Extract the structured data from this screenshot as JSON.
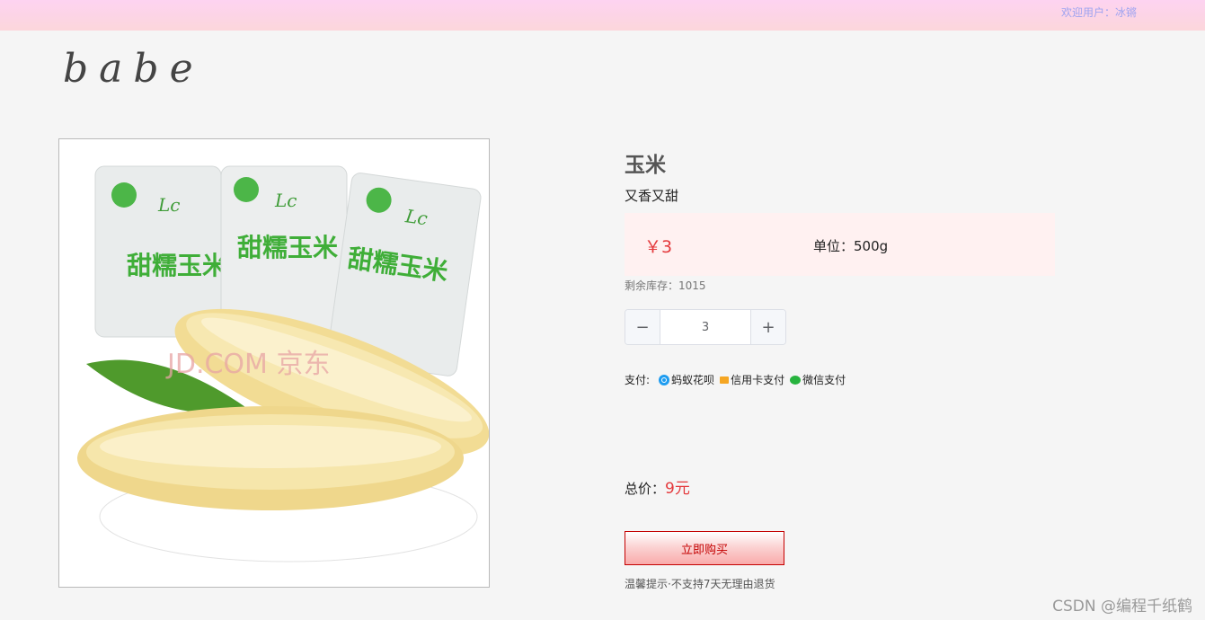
{
  "header": {
    "welcome_label": "欢迎用户：",
    "username": "冰锵"
  },
  "logo": {
    "text": "babe"
  },
  "product": {
    "name": "玉米",
    "description": "又香又甜",
    "price": "￥3",
    "unit": "单位：500g",
    "stock": "剩余库存：1015",
    "image_package_text": "甜糯玉米",
    "image_watermark": "JD.COM 京东"
  },
  "quantity": {
    "value": "3",
    "minus": "−",
    "plus": "+"
  },
  "payment": {
    "label": "支付:",
    "options": [
      {
        "label": "蚂蚁花呗",
        "icon": "huabei-icon"
      },
      {
        "label": "信用卡支付",
        "icon": "credit-card-icon"
      },
      {
        "label": "微信支付",
        "icon": "wechat-icon"
      }
    ]
  },
  "total": {
    "label": "总价：",
    "amount": "9元"
  },
  "buy_button": {
    "label": "立即购买"
  },
  "tip": "温馨提示·不支持7天无理由退货",
  "watermark": "CSDN @编程千纸鹤",
  "colors": {
    "price": "#e4393c",
    "topbar": "#fdd3f1",
    "buy_border": "#c40000"
  }
}
